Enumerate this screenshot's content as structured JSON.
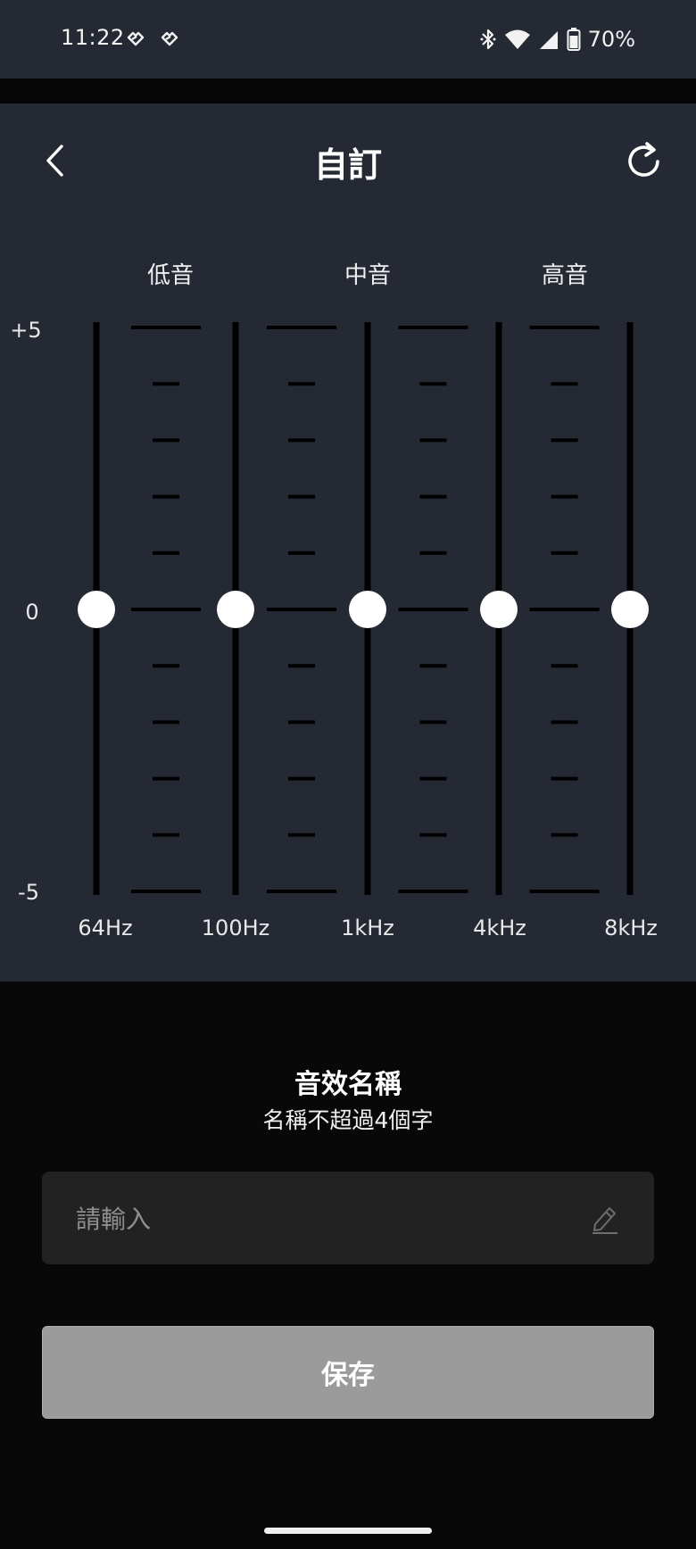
{
  "status_bar": {
    "time": "11:22",
    "battery_text": "70%",
    "icons": [
      "notification-icon",
      "notification-icon",
      "bluetooth-icon",
      "wifi-icon",
      "signal-icon",
      "battery-icon"
    ]
  },
  "header": {
    "title": "自訂",
    "back_icon": "chevron-left-icon",
    "reset_icon": "refresh-icon"
  },
  "equalizer": {
    "groups": [
      "低音",
      "中音",
      "高音"
    ],
    "scale": {
      "max_label": "+5",
      "mid_label": "0",
      "min_label": "-5",
      "min": -5,
      "max": 5
    },
    "bands": [
      {
        "label": "64Hz",
        "value": 0
      },
      {
        "label": "100Hz",
        "value": 0
      },
      {
        "label": "1kHz",
        "value": 0
      },
      {
        "label": "4kHz",
        "value": 0
      },
      {
        "label": "8kHz",
        "value": 0
      }
    ]
  },
  "name_section": {
    "title": "音效名稱",
    "subtitle": "名稱不超過4個字",
    "input_value": "",
    "input_placeholder": "請輸入",
    "edit_icon": "pencil-icon"
  },
  "save_button": {
    "label": "保存"
  },
  "colors": {
    "panel": "#252933",
    "background": "#080808",
    "save_disabled": "#9b9b9b",
    "input_background": "#222222"
  }
}
